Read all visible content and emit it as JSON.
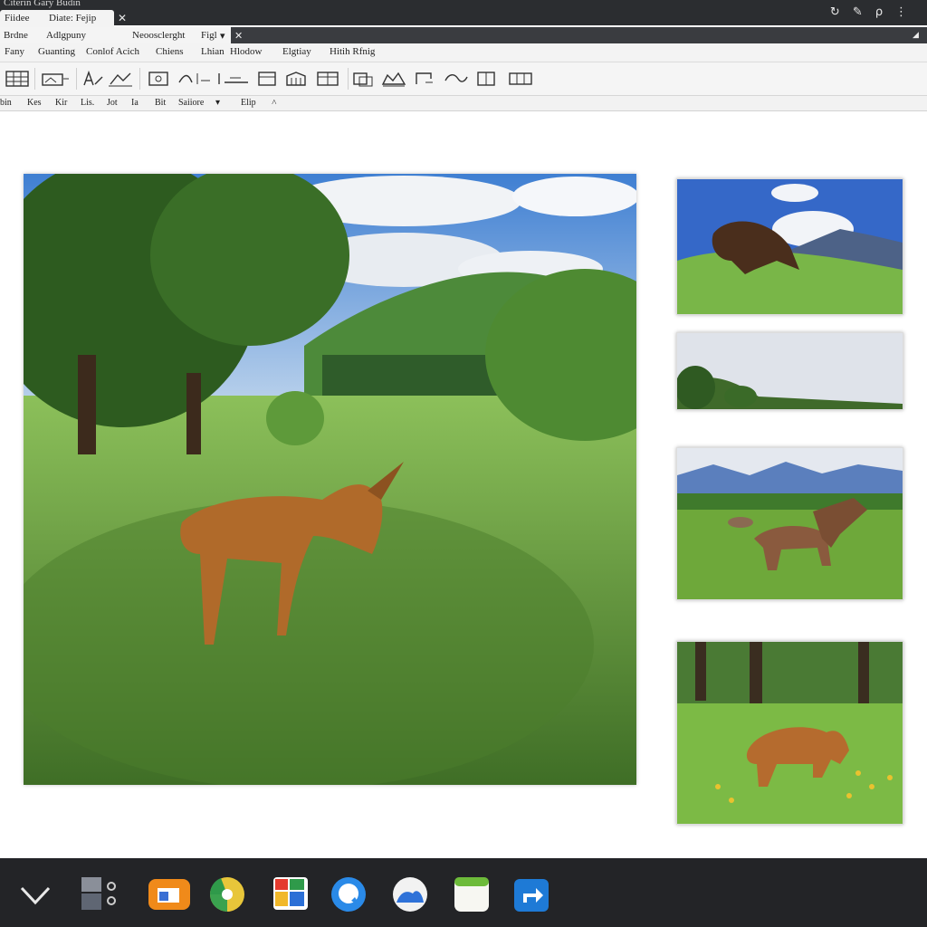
{
  "window": {
    "title": "Citerin Gary Budin"
  },
  "tabs_top": [
    {
      "label": "Fiidee"
    },
    {
      "label": "Diate: Fejip"
    }
  ],
  "tabs_second": [
    {
      "label": "Brdne"
    },
    {
      "label": "Adlgpuny"
    },
    {
      "label": "Neoosclerght"
    },
    {
      "label": "Figl"
    }
  ],
  "menu": [
    {
      "label": "Fany"
    },
    {
      "label": "Guanting"
    },
    {
      "label": "Conlof Acich"
    },
    {
      "label": "Chiens"
    },
    {
      "label": "Lhian"
    },
    {
      "label": "Hlodow"
    },
    {
      "label": "Elgtiay"
    },
    {
      "label": "Hitih Rfnig"
    }
  ],
  "format_row": [
    {
      "label": "bin"
    },
    {
      "label": "Kes"
    },
    {
      "label": "Kir"
    },
    {
      "label": "Lis."
    },
    {
      "label": "Jot"
    },
    {
      "label": "Ia"
    },
    {
      "label": "Bit"
    },
    {
      "label": "Saiiore"
    },
    {
      "label": "Elip"
    }
  ],
  "toolbar_icons": [
    "table-icon",
    "image-frame-icon",
    "draw-icon",
    "crop-icon",
    "align-icon",
    "layers-icon",
    "grid-icon",
    "split-icon",
    "transform-icon",
    "group-icon",
    "rotate-icon",
    "flip-icon",
    "box-icon",
    "resize-icon"
  ],
  "images": {
    "main": {
      "subject": "deer-grazing-in-meadow"
    },
    "thumbs": [
      {
        "subject": "boar-on-hill"
      },
      {
        "subject": "horizon-landscape"
      },
      {
        "subject": "deer-herd-mountains"
      },
      {
        "subject": "boar-in-grass"
      }
    ]
  },
  "taskbar_apps": [
    "chevron-down-icon",
    "settings-panel-icon",
    "files-app-icon",
    "chrome-icon",
    "photos-app-icon",
    "chat-app-icon",
    "cloud-app-icon",
    "notes-app-icon",
    "share-app-icon"
  ],
  "colors": {
    "titlebar": "#2b2d30",
    "taskbar": "#232427",
    "canvas": "#ffffff"
  }
}
